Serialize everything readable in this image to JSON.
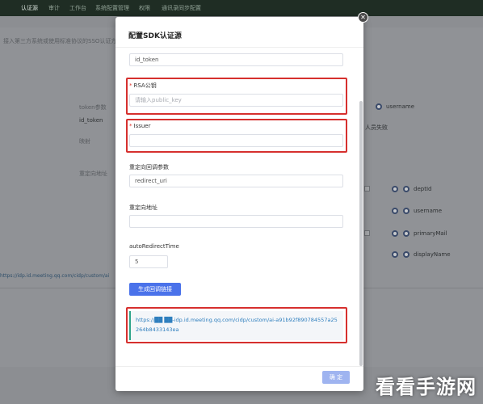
{
  "background": {
    "nav": [
      "认证源",
      "审计",
      "工作台",
      "系统配置管理",
      "权限",
      "通讯录同步配置"
    ],
    "desc": "接入第三方系统或使用标准协议的SSO认证方式",
    "token_param_label": "token参数",
    "token_param_value": "id_token",
    "field_label_a": "映射",
    "redirect_label": "重定向地址",
    "mapping_options": [
      "username",
      "deptId",
      "username",
      "primaryMail",
      "displayName"
    ],
    "extra_label": "人员失败",
    "link_text": "https://idp.id.meeting.qq.com/cidp/custom/ai"
  },
  "modal": {
    "title": "配置SDK认证源",
    "close_icon": "✕",
    "fields": {
      "token_value": "id_token",
      "rsa_label": "RSA公钥",
      "rsa_placeholder": "请输入public_key",
      "issuer_label": "Issuer",
      "issuer_value": "",
      "redirect_param_label": "重定向回调参数",
      "redirect_param_value": "redirect_uri",
      "redirect_url_label": "重定向地址",
      "redirect_url_value": "",
      "auto_redirect_label": "autoRedirectTime",
      "auto_redirect_value": "5"
    },
    "required_mark": "*",
    "generate_button": "生成回调链接",
    "generated_url": "https://██ ██-idp.id.meeting.qq.com/cidp/custom/ai-a91b92f890784557a25264b8433143ea",
    "confirm_button": "确 定"
  },
  "watermark": "看看手游网",
  "colors": {
    "primary": "#4a72ea",
    "primary_disabled": "#9fb4f0",
    "highlight": "#d6302e",
    "required": "#e0342c",
    "url_accent": "#2fa58a"
  }
}
